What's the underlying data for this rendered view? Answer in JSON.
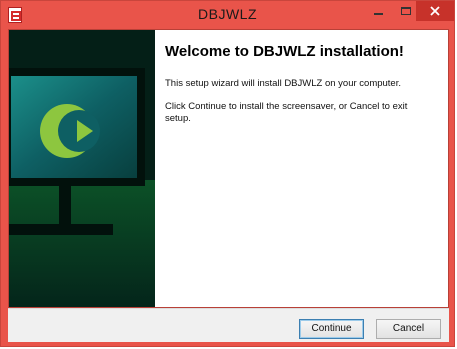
{
  "window": {
    "title": "DBJWLZ"
  },
  "content": {
    "heading": "Welcome to DBJWLZ installation!",
    "line1": "This setup wizard will install DBJWLZ on your computer.",
    "line2": "Click Continue to install the screensaver, or Cancel to exit setup."
  },
  "buttons": {
    "continue": "Continue",
    "cancel": "Cancel"
  },
  "colors": {
    "titlebar": "#e9544a",
    "close": "#c7322a",
    "banner": "#052a20",
    "logo": "#8dc63f"
  }
}
